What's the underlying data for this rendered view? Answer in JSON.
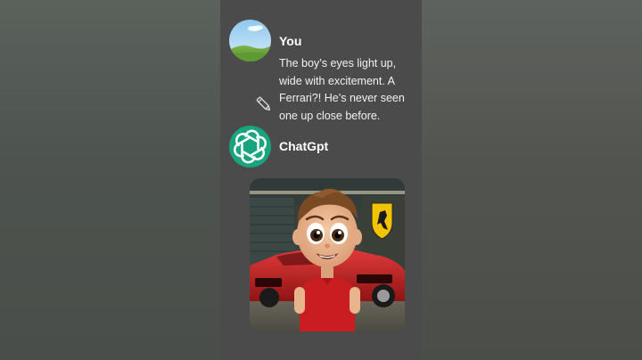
{
  "conversation": {
    "user": {
      "name": "You",
      "avatar_icon": "landscape-avatar-icon",
      "message": "The boy’s eyes light up, wide with excitement. A Ferrari?! He’s never seen one up close before.",
      "edit_icon": "pencil-icon"
    },
    "assistant": {
      "name": "ChatGpt",
      "avatar_icon": "openai-logo-icon",
      "image_description": "cartoon boy in red shirt standing in front of a red Ferrari sports car in a garage"
    }
  },
  "colors": {
    "background": "#4b4b4b",
    "assistant_avatar": "#19a37f",
    "text": "#ffffff"
  }
}
